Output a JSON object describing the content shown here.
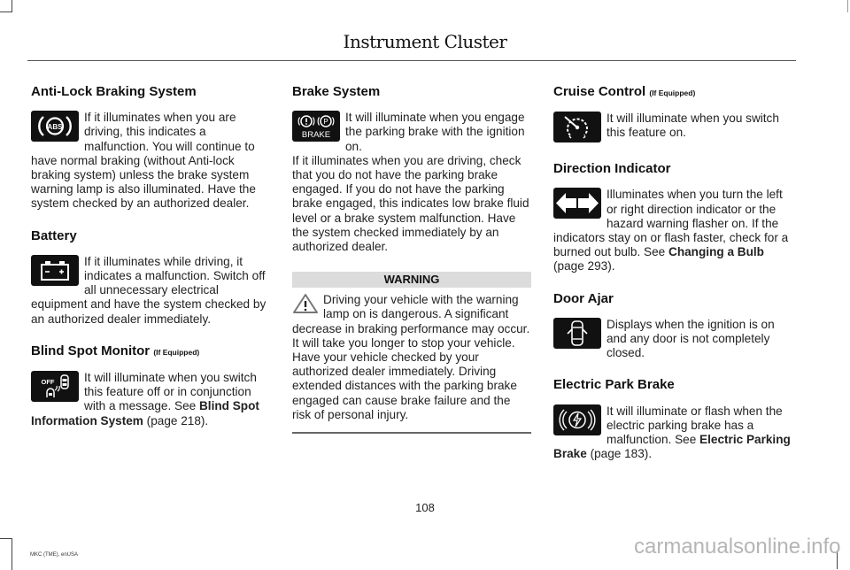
{
  "header": {
    "title": "Instrument Cluster"
  },
  "columns": [
    {
      "sections": [
        {
          "title": "Anti-Lock Braking System",
          "note": "",
          "icon": "abs-warning-icon",
          "body": "If it illuminates when you are driving, this indicates a malfunction. You will continue to have normal braking (without Anti-lock braking system) unless the brake system warning lamp is also illuminated. Have the system checked by an authorized dealer."
        },
        {
          "title": "Battery",
          "note": "",
          "icon": "battery-icon",
          "body": "If it illuminates while driving, it indicates a malfunction. Switch off all unnecessary electrical equipment and have the system checked by an authorized dealer immediately."
        },
        {
          "title": "Blind Spot Monitor",
          "note": "(If Equipped)",
          "icon": "blind-spot-off-icon",
          "icon_label": "OFF",
          "body_pre": "It will illuminate when you switch this feature off or in conjunction with a message.  See ",
          "link": "Blind Spot Information System",
          "body_post": " (page 218)."
        }
      ]
    },
    {
      "sections": [
        {
          "title": "Brake System",
          "note": "",
          "icon": "brake-warning-icon",
          "icon_label": "BRAKE",
          "body": "It will illuminate when you engage the parking brake with the ignition on.",
          "body2": "If it illuminates when you are driving, check that you do not have the parking brake engaged. If you do not have the parking brake engaged, this indicates low brake fluid level or a brake system malfunction. Have the system checked immediately by an authorized dealer."
        }
      ],
      "warning": {
        "label": "WARNING",
        "icon": "warning-triangle-icon",
        "text": "Driving your vehicle with the warning lamp on is dangerous. A significant decrease in braking performance may occur. It will take you longer to stop your vehicle. Have your vehicle checked by your authorized dealer immediately. Driving extended distances with the parking brake engaged can cause brake failure and the risk of personal injury."
      }
    },
    {
      "sections": [
        {
          "title": "Cruise Control",
          "note": "(If Equipped)",
          "icon": "cruise-control-icon",
          "body": "It will illuminate when you switch this feature on."
        },
        {
          "title": "Direction Indicator",
          "note": "",
          "icon": "direction-indicator-icon",
          "body_pre": "Illuminates when you turn the left or right direction indicator or the hazard warning flasher on. If the indicators stay on or flash faster, check for a burned out bulb.  See ",
          "link": "Changing a Bulb",
          "body_post": " (page 293)."
        },
        {
          "title": "Door Ajar",
          "note": "",
          "icon": "door-ajar-icon",
          "body": "Displays when the ignition is on and any door is not completely closed."
        },
        {
          "title": "Electric Park Brake",
          "note": "",
          "icon": "electric-park-brake-icon",
          "body_pre": "It will illuminate or flash when the electric parking brake has a malfunction.  See ",
          "link": "Electric Parking Brake",
          "body_post": " (page 183)."
        }
      ]
    }
  ],
  "footer": {
    "page_number": "108",
    "doc_id": "MKC (TME), enUSA",
    "watermark": "carmanualsonline.info"
  }
}
